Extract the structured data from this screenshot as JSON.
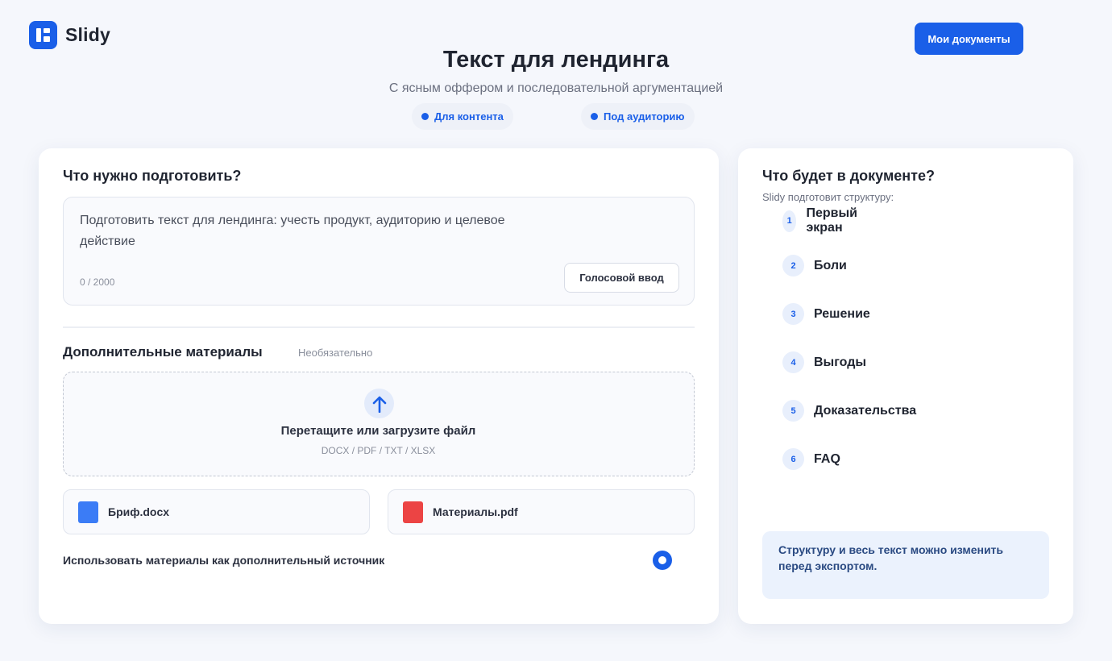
{
  "app": {
    "name": "Slidy",
    "my_docs_label": "Мои документы"
  },
  "hero": {
    "title": "Текст для лендинга",
    "subtitle": "С ясным оффером и последовательной аргументацией",
    "chips": [
      "Для контента",
      "Под аудиторию"
    ]
  },
  "task": {
    "heading": "Что нужно подготовить?",
    "text": "Подготовить текст для лендинга: учесть продукт, аудиторию и целевое действие",
    "counter": "0 / 2000",
    "voice_label": "Голосовой ввод"
  },
  "materials": {
    "heading": "Дополнительные материалы",
    "optional_label": "Необязательно",
    "drop_title": "Перетащите или загрузите файл",
    "drop_formats": "DOCX / PDF / TXT / XLSX",
    "files": [
      {
        "name": "Бриф.docx",
        "color": "#3b7cf6"
      },
      {
        "name": "Материалы.pdf",
        "color": "#ec4444"
      }
    ],
    "use_as_source_label": "Использовать материалы как дополнительный источник",
    "use_as_source_selected": true
  },
  "outline": {
    "heading": "Что будет в документе?",
    "subtitle": "Slidy подготовит структуру:",
    "steps": [
      {
        "num": "1",
        "label": "Первый экран"
      },
      {
        "num": "2",
        "label": "Боли"
      },
      {
        "num": "3",
        "label": "Решение"
      },
      {
        "num": "4",
        "label": "Выгоды"
      },
      {
        "num": "5",
        "label": "Доказательства"
      },
      {
        "num": "6",
        "label": "FAQ"
      }
    ],
    "note": "Структуру и весь текст можно изменить перед экспортом."
  },
  "colors": {
    "accent": "#1a5fe8",
    "background": "#f5f7fc",
    "note_background": "#ebf2fd"
  }
}
